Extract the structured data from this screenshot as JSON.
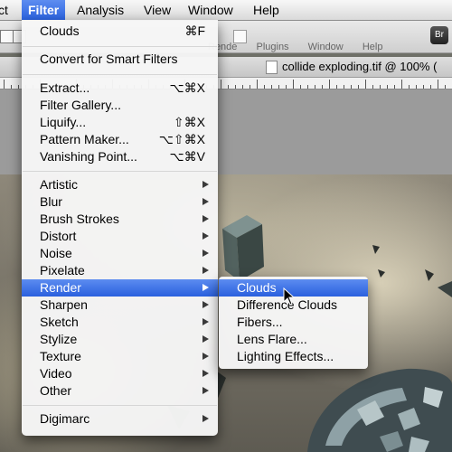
{
  "menubar": {
    "items": [
      "ct",
      "Filter",
      "Analysis",
      "View",
      "Window",
      "Help"
    ]
  },
  "panel_menus": [
    "Rende",
    "Plugins",
    "Window",
    "Help"
  ],
  "document": {
    "tab_title": "collide exploding.tif @ 100% ("
  },
  "toolbar": {
    "bridge_label": "Br"
  },
  "filter_menu": {
    "items": [
      {
        "label": "Clouds",
        "shortcut": "⌘F"
      },
      {
        "label": "Convert for Smart Filters"
      },
      {
        "label": "Extract...",
        "shortcut": "⌥⌘X"
      },
      {
        "label": "Filter Gallery..."
      },
      {
        "label": "Liquify...",
        "shortcut": "⇧⌘X"
      },
      {
        "label": "Pattern Maker...",
        "shortcut": "⌥⇧⌘X"
      },
      {
        "label": "Vanishing Point...",
        "shortcut": "⌥⌘V"
      },
      {
        "label": "Artistic",
        "submenu": true
      },
      {
        "label": "Blur",
        "submenu": true
      },
      {
        "label": "Brush Strokes",
        "submenu": true
      },
      {
        "label": "Distort",
        "submenu": true
      },
      {
        "label": "Noise",
        "submenu": true
      },
      {
        "label": "Pixelate",
        "submenu": true
      },
      {
        "label": "Render",
        "submenu": true,
        "highlighted": true
      },
      {
        "label": "Sharpen",
        "submenu": true
      },
      {
        "label": "Sketch",
        "submenu": true
      },
      {
        "label": "Stylize",
        "submenu": true
      },
      {
        "label": "Texture",
        "submenu": true
      },
      {
        "label": "Video",
        "submenu": true
      },
      {
        "label": "Other",
        "submenu": true
      },
      {
        "label": "Digimarc",
        "submenu": true
      }
    ]
  },
  "render_submenu": {
    "items": [
      {
        "label": "Clouds",
        "highlighted": true
      },
      {
        "label": "Difference Clouds"
      },
      {
        "label": "Fibers..."
      },
      {
        "label": "Lens Flare..."
      },
      {
        "label": "Lighting Effects..."
      }
    ]
  },
  "colors": {
    "highlight": "#2a60de",
    "menu_bg": "#f6f6f6"
  }
}
